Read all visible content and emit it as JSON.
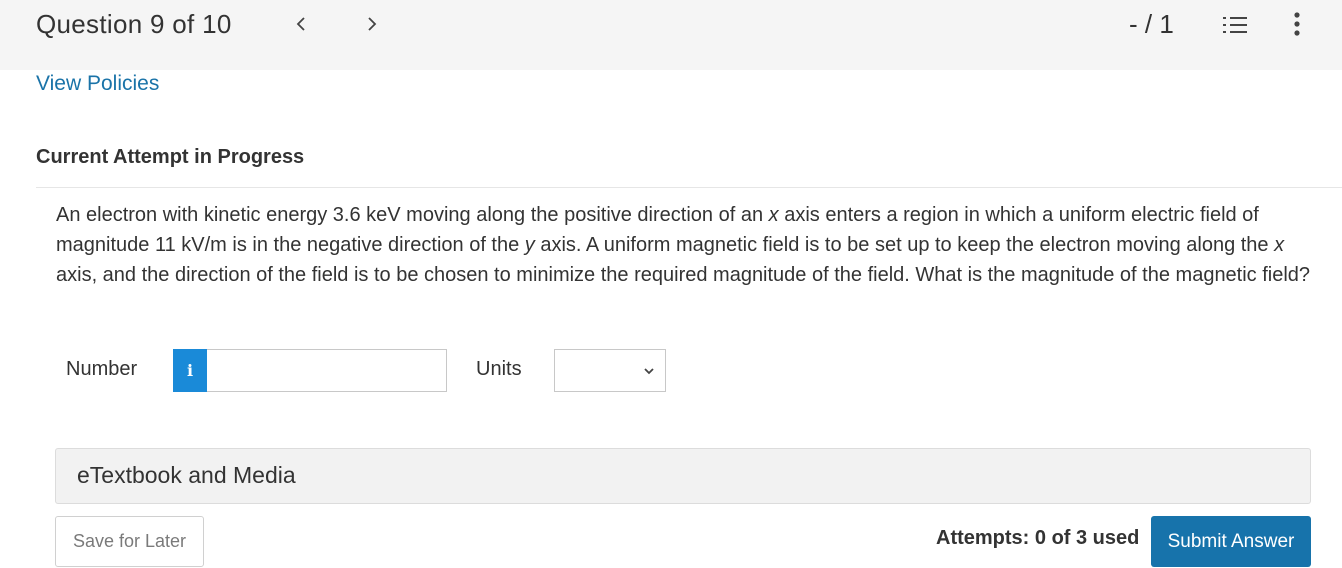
{
  "header": {
    "question_label": "Question 9 of 10",
    "score": "- / 1",
    "prev_icon": "chevron-left-icon",
    "next_icon": "chevron-right-icon",
    "list_icon": "numbered-list-icon",
    "more_icon": "more-vertical-icon"
  },
  "links": {
    "view_policies": "View Policies"
  },
  "attempt": {
    "title": "Current Attempt in Progress"
  },
  "question": {
    "part1": "An electron with kinetic energy 3.6 keV moving along the positive direction of an ",
    "var_x1": "x",
    "part2": " axis enters a region in which a uniform electric field of magnitude 11 kV/m is in the negative direction of the ",
    "var_y": "y",
    "part3": " axis. A uniform magnetic field is to be set up to keep the electron moving along the ",
    "var_x2": "x",
    "part4": " axis, and the direction of the field is to be chosen to minimize the required magnitude of the field. What is the magnitude of the magnetic field?"
  },
  "answer": {
    "number_label": "Number",
    "info_glyph": "i",
    "number_value": "",
    "units_label": "Units",
    "units_value": ""
  },
  "etextbook": {
    "label": "eTextbook and Media"
  },
  "footer": {
    "save_label": "Save for Later",
    "attempts_text": "Attempts: 0 of 3 used",
    "submit_label": "Submit Answer"
  },
  "colors": {
    "accent": "#1773ab",
    "link": "#1a73a8",
    "info": "#1a8ad8",
    "topbar": "#f5f5f5"
  }
}
